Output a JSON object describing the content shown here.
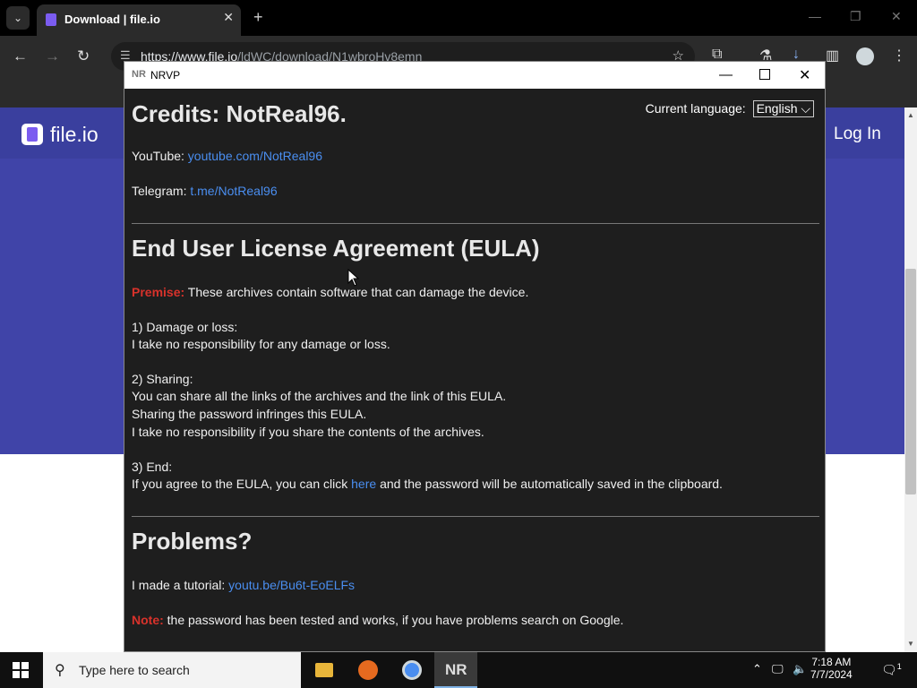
{
  "browser": {
    "tab_title": "Download | file.io",
    "url_domain": "https://www.file.io",
    "url_path": "/ldWC/download/N1wbroHv8emn",
    "icons": [
      "tab-list-icon",
      "close-icon",
      "new-tab-icon",
      "back-icon",
      "forward-icon",
      "reload-icon",
      "site-settings-icon",
      "star-icon",
      "extensions-icon",
      "labs-icon",
      "downloads-icon",
      "sidebar-icon",
      "profile-icon",
      "menu-icon"
    ]
  },
  "site": {
    "logo_text": "file.io",
    "login_label": "Log In"
  },
  "nrvp": {
    "window_title": "NRVP",
    "app_icon_text": "NR",
    "language_label": "Current language:",
    "language_value": "English",
    "credits_heading": "Credits: NotReal96.",
    "youtube_label": "YouTube:",
    "youtube_link": "youtube.com/NotReal96",
    "telegram_label": "Telegram:",
    "telegram_link": "t.me/NotReal96",
    "eula_heading": "End User License Agreement (EULA)",
    "premise_label": "Premise:",
    "premise_text": "These archives contain software that can damage the device.",
    "s1_title": "1) Damage or loss:",
    "s1_line1": "I take no responsibility for any damage or loss.",
    "s2_title": "2) Sharing:",
    "s2_line1": "You can share all the links of the archives and the link of this EULA.",
    "s2_line2": "Sharing the password infringes this EULA.",
    "s2_line3": "I take no responsibility if you share the contents of the archives.",
    "s3_title": "3) End:",
    "s3_before": "If you agree to the EULA, you can click",
    "s3_link": "here",
    "s3_after": "and the password will be automatically saved in the clipboard.",
    "problems_heading": "Problems?",
    "tutorial_label": "I made a tutorial:",
    "tutorial_link": "youtu.be/Bu6t-EoELFs",
    "note_label": "Note:",
    "note_text": "the password has been tested and works, if you have problems search on Google."
  },
  "taskbar": {
    "search_placeholder": "Type here to search",
    "nr_app_label": "NR",
    "time": "7:18 AM",
    "date": "7/7/2024",
    "notification_count": "1"
  },
  "colors": {
    "accent_link": "#4a8ef0",
    "warning_red": "#d8322b",
    "site_header": "#3a3f9e"
  }
}
